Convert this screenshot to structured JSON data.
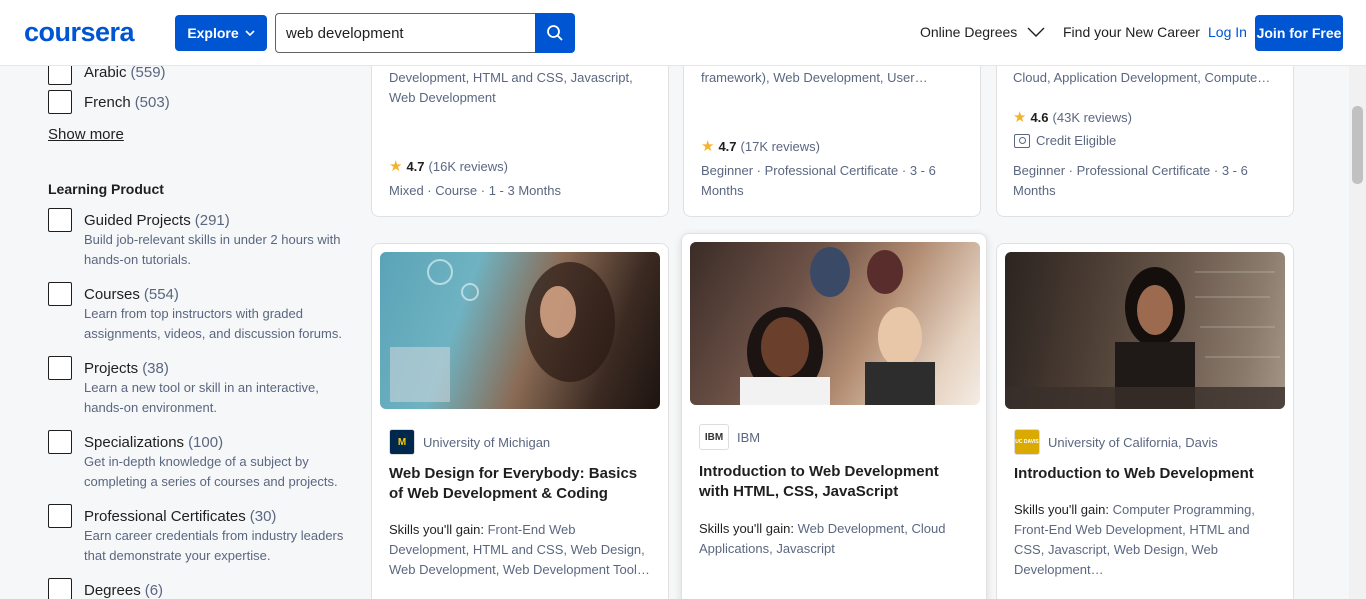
{
  "header": {
    "logo": "coursera",
    "explore_label": "Explore",
    "search_value": "web development",
    "nav_online_degrees": "Online Degrees",
    "nav_find_career": "Find your New Career",
    "login_label": "Log In",
    "join_label": "Join for Free"
  },
  "sidebar": {
    "languages": [
      {
        "label": "Arabic",
        "count": "(559)"
      },
      {
        "label": "French",
        "count": "(503)"
      }
    ],
    "show_more": "Show more",
    "learning_product_title": "Learning Product",
    "products": [
      {
        "label": "Guided Projects",
        "count": "(291)",
        "desc": "Build job-relevant skills in under 2 hours with hands-on tutorials."
      },
      {
        "label": "Courses",
        "count": "(554)",
        "desc": "Learn from top instructors with graded assignments, videos, and discussion forums."
      },
      {
        "label": "Projects",
        "count": "(38)",
        "desc": "Learn a new tool or skill in an interactive, hands-on environment."
      },
      {
        "label": "Specializations",
        "count": "(100)",
        "desc": "Get in-depth knowledge of a subject by completing a series of courses and projects."
      },
      {
        "label": "Professional Certificates",
        "count": "(30)",
        "desc": "Earn career credentials from industry leaders that demonstrate your expertise."
      },
      {
        "label": "Degrees",
        "count": "(6)",
        "desc": ""
      }
    ]
  },
  "cards_top": [
    {
      "skills_tail": "Development, HTML and CSS, Javascript, Web Development",
      "rating": "4.7",
      "reviews": "(16K reviews)",
      "meta": "Mixed · Course · 1 - 3 Months"
    },
    {
      "skills_tail": "framework), Web Development, User…",
      "rating": "4.7",
      "reviews": "(17K reviews)",
      "meta": "Beginner · Professional Certificate · 3 - 6 Months"
    },
    {
      "skills_tail": "Cloud, Application Development, Compute…",
      "rating": "4.6",
      "reviews": "(43K reviews)",
      "credit": "Credit Eligible",
      "meta": "Beginner · Professional Certificate · 3 - 6 Months"
    }
  ],
  "cards_bottom": [
    {
      "partner": "University of Michigan",
      "partner_logo": "M",
      "title": "Web Design for Everybody: Basics of Web Development & Coding",
      "skills_label": "Skills you'll gain:",
      "skills": "Front-End Web Development, HTML and CSS, Web Design, Web Development, Web Development Tool…"
    },
    {
      "partner": "IBM",
      "partner_logo": "IBM",
      "title": "Introduction to Web Development with HTML, CSS, JavaScript",
      "skills_label": "Skills you'll gain:",
      "skills": "Web Development, Cloud Applications, Javascript"
    },
    {
      "partner": "University of California, Davis",
      "partner_logo": "UC DAVIS",
      "title": "Introduction to Web Development",
      "skills_label": "Skills you'll gain:",
      "skills": "Computer Programming, Front-End Web Development, HTML and CSS, Javascript, Web Design, Web Development…"
    }
  ],
  "colors": {
    "brand": "#0056d2",
    "star": "#f5b32a",
    "michigan_blue": "#00274c",
    "michigan_maize": "#ffcb05",
    "ucdavis_gold": "#daaa00"
  }
}
